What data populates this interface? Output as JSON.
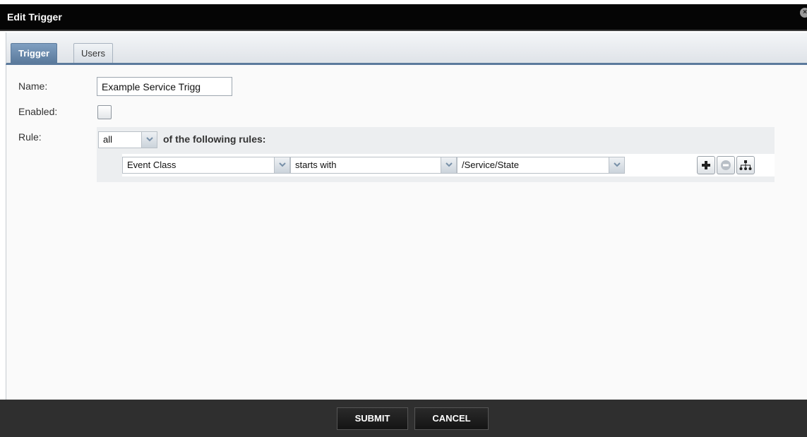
{
  "window": {
    "title": "Edit Trigger",
    "close_glyph": "×"
  },
  "tabs": [
    {
      "label": "Trigger",
      "active": true
    },
    {
      "label": "Users",
      "active": false
    }
  ],
  "form": {
    "name_label": "Name:",
    "name_value": "Example Service Trigg",
    "enabled_label": "Enabled:",
    "enabled_checked": false,
    "rule_label": "Rule:",
    "rule_quantifier": "all",
    "rule_suffix": "of the following rules:",
    "rules": [
      {
        "field": "Event Class",
        "operator": "starts with",
        "value": "/Service/State"
      }
    ]
  },
  "rule_actions": [
    {
      "icon": "add-icon"
    },
    {
      "icon": "remove-icon"
    },
    {
      "icon": "nested-rule-icon"
    }
  ],
  "footer": {
    "submit_label": "SUBMIT",
    "cancel_label": "CANCEL"
  },
  "colors": {
    "titlebar": "#050505",
    "tab_active": "#5b7a9c",
    "footer": "#2f2f2f"
  }
}
